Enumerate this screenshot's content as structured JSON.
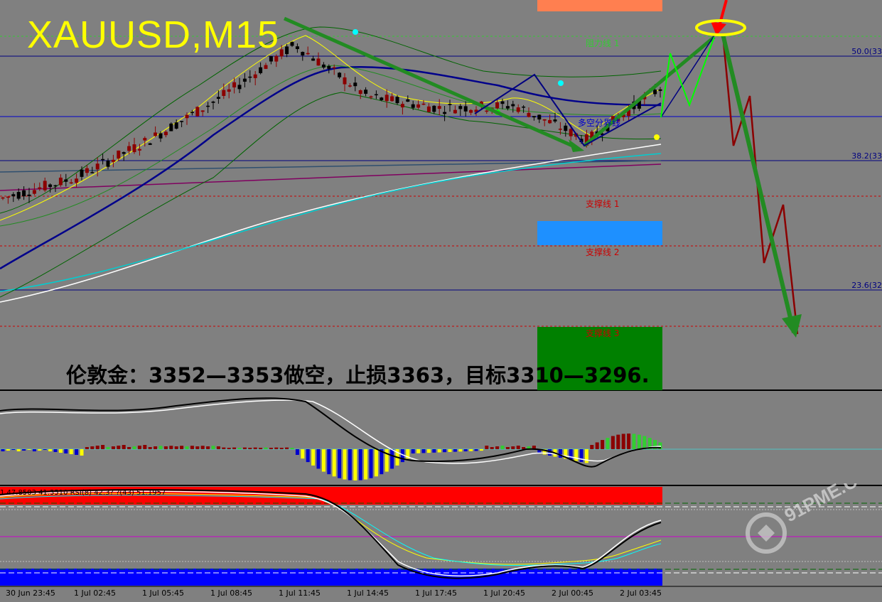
{
  "symbol_title": "XAUUSD,M15",
  "comment": "伦敦金：3352—3353做空，止损3363，目标3310—3296.",
  "levels": {
    "resistance_1": "阻力线 1",
    "bull_bear_line": "多空分界线",
    "support_1": "支撑线 1",
    "support_2": "支撑线 2",
    "support_3": "支撑线 3"
  },
  "fibo": {
    "f50": "50.0(33",
    "f382": "38.2(33",
    "f236": "23.6(32"
  },
  "indicator_label": "1 47.8503 41.3510  RSI(8) 42.3?  ?(43) 51.1957",
  "x_ticks": [
    "30 Jun 23:45",
    "1 Jul 02:45",
    "1 Jul 05:45",
    "1 Jul 08:45",
    "1 Jul 11:45",
    "1 Jul 14:45",
    "1 Jul 17:45",
    "1 Jul 20:45",
    "2 Jul 00:45",
    "2 Jul 03:45"
  ],
  "watermark": "91PME.COM",
  "colors": {
    "background": "#808080",
    "bull_candle": "#8b0000",
    "bear_candle": "#000000",
    "forecast_green": "#228b22",
    "forecast_red": "#8b0000",
    "title": "#ffff00"
  },
  "chart_data": {
    "type": "line",
    "title": "XAUUSD,M15",
    "x": [
      "30 Jun 23:45",
      "1 Jul 02:45",
      "1 Jul 05:45",
      "1 Jul 08:45",
      "1 Jul 11:45",
      "1 Jul 14:45",
      "1 Jul 17:45",
      "1 Jul 20:45",
      "2 Jul 00:45",
      "2 Jul 03:45"
    ],
    "series": [
      {
        "values": [
          3305,
          3312,
          3325,
          3340,
          3358,
          3340,
          3336,
          3337,
          3325,
          3343
        ]
      }
    ],
    "trade_plan": {
      "entry": [
        3352,
        3353
      ],
      "stop_loss": 3363,
      "targets": [
        3310,
        3296
      ]
    },
    "fibonacci_levels": [
      "50.0",
      "38.2",
      "23.6"
    ]
  }
}
